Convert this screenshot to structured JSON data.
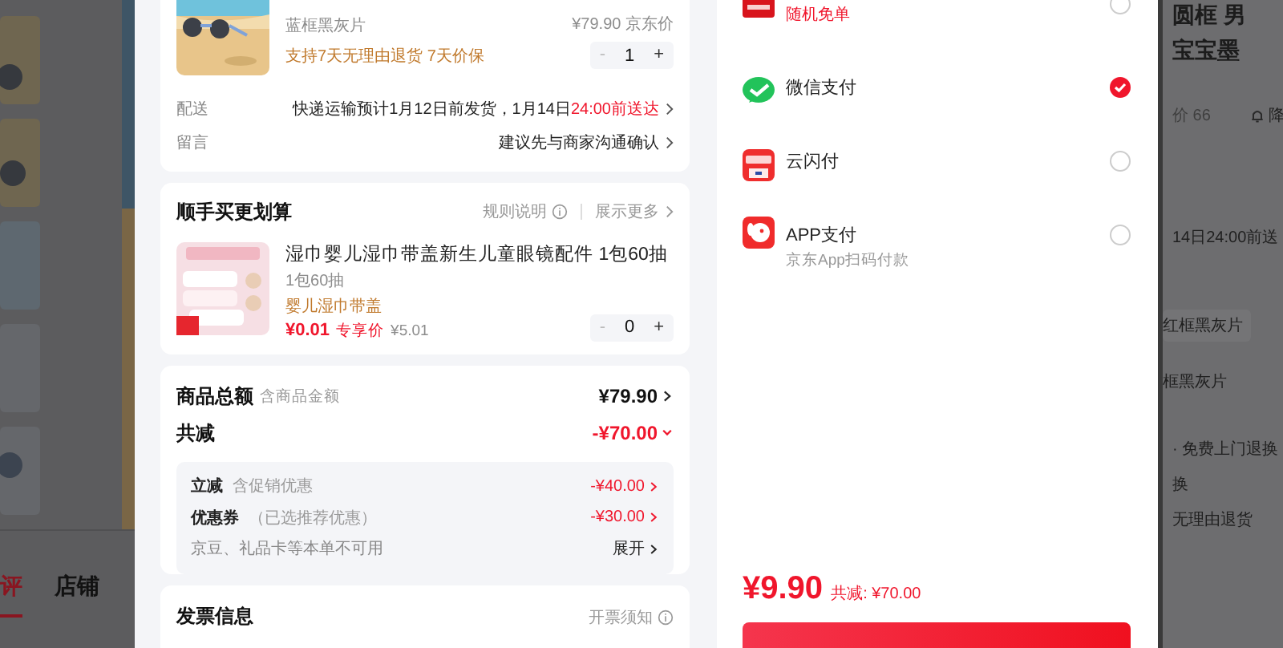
{
  "background_left": {
    "tabs": [
      {
        "label": "评",
        "selected": true
      },
      {
        "label": "店铺",
        "selected": false
      }
    ]
  },
  "order": {
    "product": {
      "variant": "蓝框黑灰片",
      "services": "支持7天无理由退货  7天价保",
      "price": "¥79.90",
      "price_label": "京东价",
      "minus": "-",
      "quantity": "1",
      "plus": "+"
    },
    "details": [
      {
        "label": "配送",
        "value": "快递运输预计1月12日前发货，1月14日",
        "highlight": "24:00前送达"
      },
      {
        "label": "留言",
        "value": "建议先与商家沟通确认"
      }
    ],
    "addon": {
      "title": "顺手买更划算",
      "rules": "规则说明",
      "more": "展示更多",
      "item": {
        "title": "湿巾婴儿湿巾带盖新生儿童眼镜配件 1包60抽",
        "spec": "1包60抽",
        "tag": "婴儿湿巾带盖",
        "price": "¥0.01",
        "price_label": "专享价",
        "original": "¥5.01",
        "minus": "-",
        "quantity": "0",
        "plus": "+"
      }
    },
    "summary": {
      "rows": [
        {
          "kind": "total",
          "label": "商品总额",
          "note": "含商品金额",
          "amount": "¥79.90",
          "expanded": false
        },
        {
          "kind": "discount",
          "label": "共减",
          "amount": "-¥70.00",
          "expanded": true
        }
      ],
      "breakdown": [
        {
          "kind": "discount",
          "label": "立减",
          "note": "含促销优惠",
          "amount": "-¥40.00"
        },
        {
          "kind": "discount",
          "label": "优惠券",
          "note": "（已选推荐优惠）",
          "amount": "-¥30.00"
        },
        {
          "kind": "unavailable",
          "label": "京豆、礼品卡等本单不可用",
          "action": "展开"
        }
      ]
    },
    "invoice": {
      "title": "发票信息",
      "notice": "开票须知"
    }
  },
  "payment": {
    "methods": [
      {
        "kind": "card",
        "promo": "随机免单",
        "selected": false
      },
      {
        "kind": "wechat",
        "title": "微信支付",
        "selected": true
      },
      {
        "kind": "unionpay",
        "title": "云闪付",
        "selected": false
      },
      {
        "kind": "app",
        "title": "APP支付",
        "note": "京东App扫码付款",
        "selected": false
      }
    ],
    "total": "¥9.90",
    "saving": "共减: ¥70.00"
  },
  "background_right": [
    {
      "kind": "title",
      "text": "圆框 男"
    },
    {
      "kind": "title",
      "text": "宝宝墨"
    },
    {
      "kind": "meta",
      "text": "价 66",
      "alert": "降"
    },
    {
      "kind": "text",
      "text": "14日24:00前送"
    },
    {
      "kind": "chip",
      "text": "红框黑灰片"
    },
    {
      "kind": "chip",
      "text": "框黑灰片"
    },
    {
      "kind": "text",
      "text": "· 免费上门退换"
    },
    {
      "kind": "text",
      "text": "换"
    },
    {
      "kind": "text",
      "text": "无理由退货"
    }
  ]
}
